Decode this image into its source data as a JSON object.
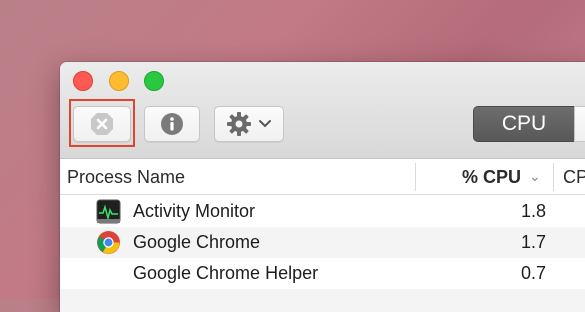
{
  "toolbar": {
    "view_tabs": [
      "CPU"
    ]
  },
  "table": {
    "columns": [
      "Process Name",
      "% CPU",
      "CP"
    ],
    "sort_indicator": "chevron-down",
    "rows": [
      {
        "name": "Activity Monitor",
        "cpu": "1.8",
        "icon": "activity-monitor-icon"
      },
      {
        "name": "Google Chrome",
        "cpu": "1.7",
        "icon": "chrome-icon"
      },
      {
        "name": "Google Chrome Helper",
        "cpu": "0.7",
        "icon": ""
      }
    ]
  },
  "colors": {
    "accent_highlight": "#e2452e",
    "segment_selected": "#636363"
  }
}
